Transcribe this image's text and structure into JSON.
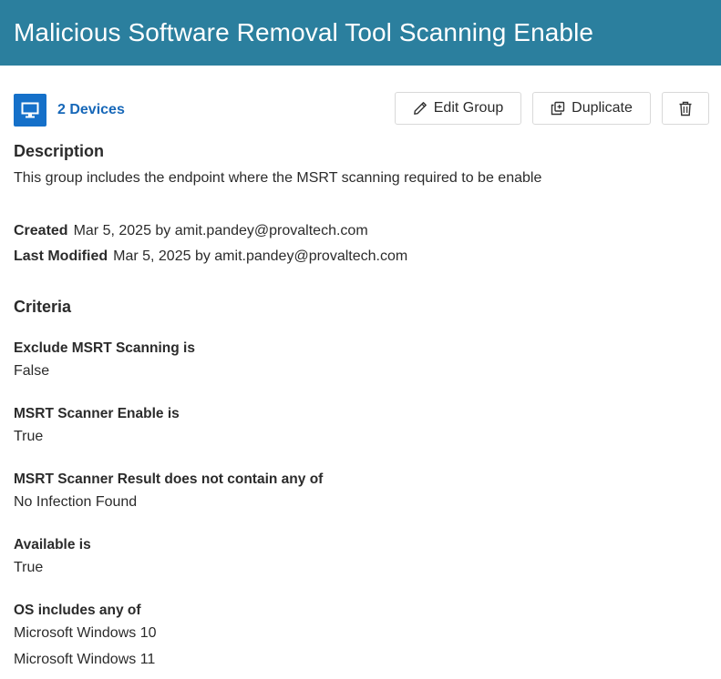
{
  "header": {
    "title": "Malicious Software Removal Tool Scanning Enable"
  },
  "toolbar": {
    "devices_label": "2 Devices",
    "edit_label": "Edit Group",
    "duplicate_label": "Duplicate",
    "devices_icon": "monitor-icon",
    "edit_icon": "pencil-icon",
    "duplicate_icon": "duplicate-icon",
    "delete_icon": "trash-icon"
  },
  "description": {
    "title": "Description",
    "text": "This group includes the endpoint where the MSRT scanning required to be enable"
  },
  "meta": {
    "created_label": "Created",
    "created_value": "Mar 5, 2025 by amit.pandey@provaltech.com",
    "modified_label": "Last Modified",
    "modified_value": "Mar 5, 2025 by amit.pandey@provaltech.com"
  },
  "criteria": {
    "title": "Criteria",
    "items": [
      {
        "label": "Exclude MSRT Scanning is",
        "values": [
          "False"
        ]
      },
      {
        "label": "MSRT Scanner Enable is",
        "values": [
          "True"
        ]
      },
      {
        "label": "MSRT Scanner Result does not contain any of",
        "values": [
          "No Infection Found"
        ]
      },
      {
        "label": "Available is",
        "values": [
          "True"
        ]
      },
      {
        "label": "OS includes any of",
        "values": [
          "Microsoft Windows 10",
          "Microsoft Windows 11"
        ]
      }
    ]
  },
  "colors": {
    "header_bg": "#2b7f9e",
    "accent": "#1570c9",
    "link": "#1667b8"
  }
}
